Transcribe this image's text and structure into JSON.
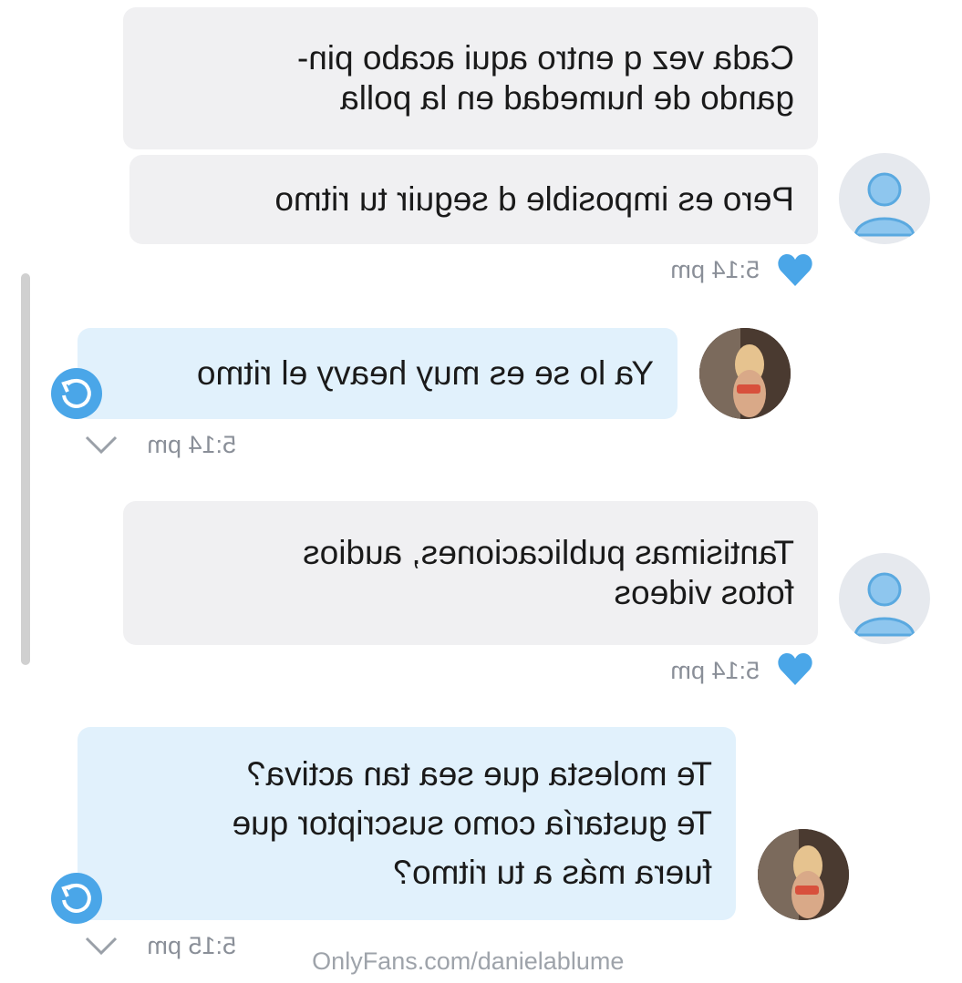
{
  "messages": [
    {
      "sender": "fan",
      "lines": [
        "Cada vez q entro aqui acabo pin-",
        "gando de humedad en la polla"
      ]
    },
    {
      "sender": "fan",
      "lines": [
        "Pero es imposible d seguir tu ritmo"
      ],
      "time": "5:14 pm",
      "liked": true
    },
    {
      "sender": "creator",
      "lines": [
        "Ya lo se es muy heavy el ritmo"
      ],
      "time": "5:14 pm"
    },
    {
      "sender": "fan",
      "lines": [
        "Tantisimas publicaciones, audios",
        "fotos videos"
      ],
      "time": "5:14 pm",
      "liked": true
    },
    {
      "sender": "creator",
      "lines": [
        "Te molesta que sea tan activa?",
        "Te gustaría como suscriptor que",
        "fuera más a tu ritmo?"
      ],
      "time": "5:15 pm"
    }
  ],
  "watermark": "OnlyFans.com/danielablume",
  "colors": {
    "grey_bubble": "#f0f0f2",
    "blue_bubble": "#e1f1fc",
    "accent": "#4aa6e8",
    "time": "#8a8f98"
  },
  "icons": {
    "like": "heart-icon",
    "reply": "reply-icon",
    "status": "chevron-down-icon",
    "default_avatar": "user-icon"
  }
}
